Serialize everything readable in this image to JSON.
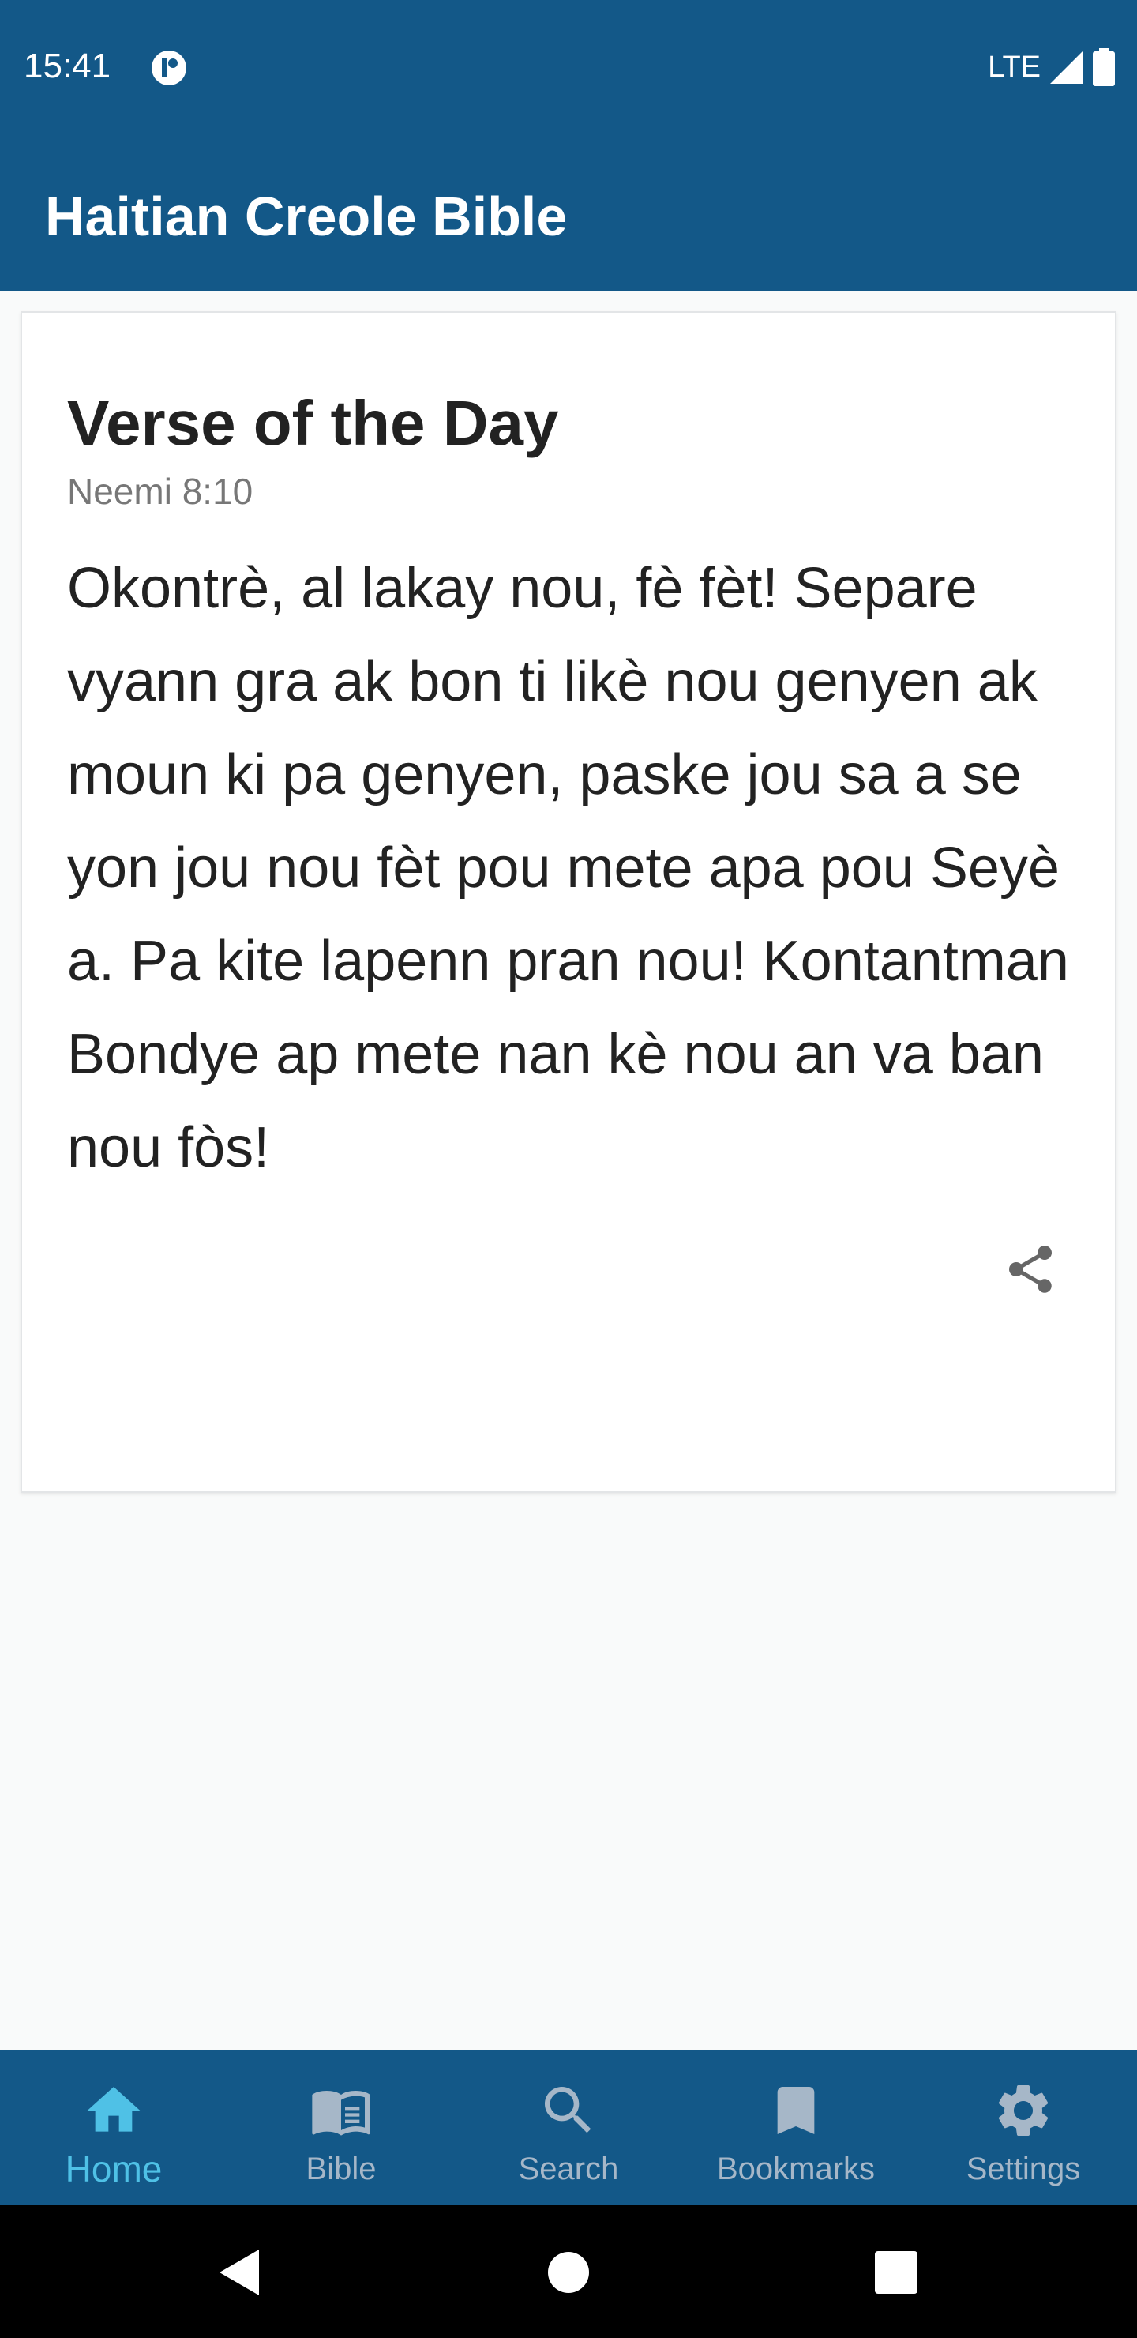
{
  "status_bar": {
    "time": "15:41",
    "network": "LTE"
  },
  "app_bar": {
    "title": "Haitian Creole Bible"
  },
  "verse_card": {
    "title": "Verse of the Day",
    "reference": "Neemi 8:10",
    "text": "Okontrè, al lakay nou, fè fèt! Separe vyann gra ak bon ti likè nou genyen ak moun ki pa genyen, paske jou sa a se yon jou nou fèt pou mete apa pou Seyè a. Pa kite lapenn pran nou! Kontantman Bondye ap mete nan kè nou an va ban nou fòs!",
    "share_icon": "share-icon"
  },
  "bottom_nav": {
    "items": [
      {
        "label": "Home",
        "icon": "home-icon",
        "active": true
      },
      {
        "label": "Bible",
        "icon": "book-icon",
        "active": false
      },
      {
        "label": "Search",
        "icon": "search-icon",
        "active": false
      },
      {
        "label": "Bookmarks",
        "icon": "bookmark-icon",
        "active": false
      },
      {
        "label": "Settings",
        "icon": "gear-icon",
        "active": false
      }
    ]
  },
  "colors": {
    "primary": "#135888",
    "active": "#4fc1e6",
    "inactive": "#a6b7c8",
    "background": "#f9fafa"
  }
}
